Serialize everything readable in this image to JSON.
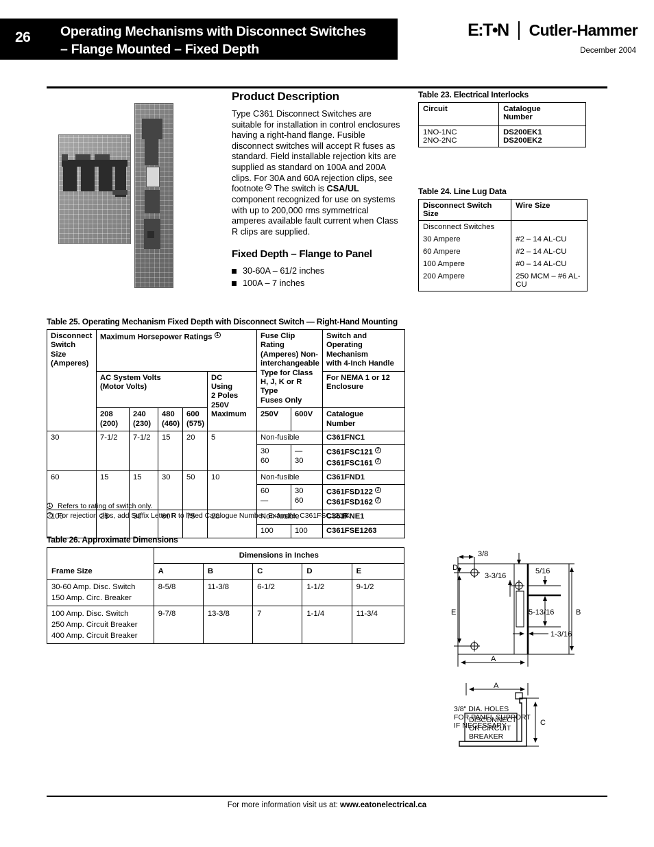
{
  "header": {
    "page_number": "26",
    "title_line1": "Operating Mechanisms with Disconnect Switches",
    "title_line2": "– Flange Mounted – Fixed Depth",
    "brand_primary": "E:T•N",
    "brand_secondary": "Cutler-Hammer",
    "date": "December 2004"
  },
  "product_description": {
    "heading": "Product Description",
    "body": "Type C361 Disconnect Switches are suitable for installation in control enclosures having a right-hand flange. Fusible disconnect switches will accept R fuses as standard. Field installable rejection kits are supplied as standard on 100A and 200A clips. For 30A and 60A rejection clips, see footnote ② The switch is CSA/UL component recognized for use on systems with up to 200,000 rms symmetrical amperes available fault current when Class R clips are supplied.",
    "body_part1": "Type C361 Disconnect Switches are suitable for installation in control enclosures having a right-hand flange. Fusible disconnect switches will accept R fuses as standard. Field installable rejection kits are supplied as standard on 100A and 200A clips. For 30A and 60A rejection clips, see footnote ",
    "body_part2": "The switch is ",
    "body_bold": "CSA/UL",
    "body_part3": " component recognized for use on systems with up to 200,000 rms symmetrical amperes available fault current when Class R clips are supplied.",
    "fixed_depth_heading": "Fixed Depth – Flange to Panel",
    "bullets": [
      "30-60A – 61/2 inches",
      "100A – 7 inches"
    ]
  },
  "table23": {
    "caption": "Table 23. Electrical Interlocks",
    "headers": [
      "Circuit",
      "Catalogue\nNumber"
    ],
    "header_circuit": "Circuit",
    "header_cat_l1": "Catalogue",
    "header_cat_l2": "Number",
    "rows": [
      {
        "circuit": "1NO-1NC",
        "catalogue": "DS200EK1"
      },
      {
        "circuit": "2NO-2NC",
        "catalogue": "DS200EK2"
      }
    ]
  },
  "table24": {
    "caption": "Table 24. Line Lug Data",
    "header_switch_size": "Disconnect Switch Size",
    "header_wire_size": "Wire Size",
    "group_label": "Disconnect Switches",
    "rows": [
      {
        "size": "30 Ampere",
        "wire": "#2 – 14 AL-CU"
      },
      {
        "size": "60 Ampere",
        "wire": "#2 – 14 AL-CU"
      },
      {
        "size": "100 Ampere",
        "wire": "#0 – 14 AL-CU"
      },
      {
        "size": "200 Ampere",
        "wire": "250 MCM – #6 AL-CU"
      }
    ]
  },
  "table25": {
    "caption": "Table 25. Operating Mechanism Fixed Depth with Disconnect Switch — Right-Hand Mounting",
    "h_switch_size_l1": "Disconnect",
    "h_switch_size_l2": "Switch Size",
    "h_switch_size_l3": "(Amperes)",
    "h_max_hp": "Maximum Horsepower Ratings ",
    "h_max_hp_fn": "①",
    "h_fuse_clip_l1": "Fuse Clip Rating",
    "h_fuse_clip_l2": "(Amperes) Non-",
    "h_fuse_clip_l3": "interchangeable",
    "h_fuse_clip_l4": "Type for Class",
    "h_fuse_clip_l5": "H, J, K or R Type",
    "h_fuse_clip_l6": "Fuses Only",
    "h_switch_op_l1": "Switch and Operating",
    "h_switch_op_l2": "Mechanism",
    "h_switch_op_l3": "with 4-Inch Handle",
    "h_nema_l1": "For NEMA 1 or 12",
    "h_nema_l2": "Enclosure",
    "h_ac_l1": "AC System Volts",
    "h_ac_l2": "(Motor Volts)",
    "h_dc_l1": "DC",
    "h_dc_l2": "Using",
    "h_dc_l3": "2 Poles",
    "h_dc_l4": "250V",
    "h_dc_l5": "Maximum",
    "h_v208_l1": "208",
    "h_v208_l2": "(200)",
    "h_v240_l1": "240",
    "h_v240_l2": "(230)",
    "h_v480_l1": "480",
    "h_v480_l2": "(460)",
    "h_v600_l1": "600",
    "h_v600_l2": "(575)",
    "h_250v": "250V",
    "h_600v": "600V",
    "h_cat_l1": "Catalogue",
    "h_cat_l2": "Number",
    "rows": [
      {
        "switch_size": "30",
        "hp208": "7-1/2",
        "hp240": "7-1/2",
        "hp480": "15",
        "hp600": "20",
        "dc": "5",
        "nonfusible_label": "Non-fusible",
        "nonfusible_cat": "C361FNC1",
        "fuse_rows": [
          {
            "v250": "30",
            "v600": "—",
            "cat": "C361FSC121",
            "fn": "②"
          },
          {
            "v250": "60",
            "v600": "30",
            "cat": "C361FSC161",
            "fn": "②"
          }
        ]
      },
      {
        "switch_size": "60",
        "hp208": "15",
        "hp240": "15",
        "hp480": "30",
        "hp600": "50",
        "dc": "10",
        "nonfusible_label": "Non-fusible",
        "nonfusible_cat": "C361FND1",
        "fuse_rows": [
          {
            "v250": "60",
            "v600": "30",
            "cat": "C361FSD122",
            "fn": "②"
          },
          {
            "v250": "—",
            "v600": "60",
            "cat": "C361FSD162",
            "fn": "②"
          }
        ]
      },
      {
        "switch_size": "100",
        "hp208": "25",
        "hp240": "30",
        "hp480": "60",
        "hp600": "75",
        "dc": "20",
        "nonfusible_label": "Non-fusible",
        "nonfusible_cat": "C361FNE1",
        "fuse_rows": [
          {
            "v250": "100",
            "v600": "100",
            "cat": "C361FSE1263",
            "fn": ""
          }
        ]
      }
    ],
    "footnotes": [
      {
        "marker": "①",
        "text": "Refers to rating of switch only."
      },
      {
        "marker": "②",
        "text_pre": "For rejection clips, add Suffix Letter ",
        "bold": "R",
        "text_post": " to listed Catalogue Number. Example: C361FSC121",
        "bold2": "R",
        "text_end": "."
      }
    ]
  },
  "table26": {
    "caption": "Table 26. Approximate Dimensions",
    "h_frame_size": "Frame Size",
    "h_dimensions": "Dimensions in Inches",
    "cols": [
      "A",
      "B",
      "C",
      "D",
      "E"
    ],
    "rows": [
      {
        "frame_lines": [
          "30-60 Amp. Disc. Switch",
          "150 Amp. Circ. Breaker"
        ],
        "A": "8-5/8",
        "B": "11-3/8",
        "C": "6-1/2",
        "D": "1-1/2",
        "E": "9-1/2"
      },
      {
        "frame_lines": [
          "100 Amp. Disc. Switch",
          "250 Amp. Circuit Breaker",
          "400 Amp. Circuit Breaker"
        ],
        "A": "9-7/8",
        "B": "13-3/8",
        "C": "7",
        "D": "1-1/4",
        "E": "11-3/4"
      }
    ]
  },
  "drawing": {
    "labels": {
      "dim_38": "3/8",
      "dim_3_3_16": "3-3/16",
      "dim_5_16": "5/16",
      "dim_5_13_16": "5-13/16",
      "dim_1_3_16": "1-3/16",
      "letter_D": "D",
      "letter_E": "E",
      "letter_B": "B",
      "letter_A": "A",
      "letter_A2": "A",
      "letter_C": "C",
      "note_l1": "3/8\" DIA. HOLES",
      "note_l2": "FOR PANEL SUPPORT",
      "note_l3": "IF NECESSARY",
      "box_l1": "DISCONNECT",
      "box_l2": "OR CIRCUIT",
      "box_l3": "BREAKER"
    }
  },
  "footer": {
    "prefix": "For more information visit us at: ",
    "url": "www.eatonelectrical.ca"
  }
}
